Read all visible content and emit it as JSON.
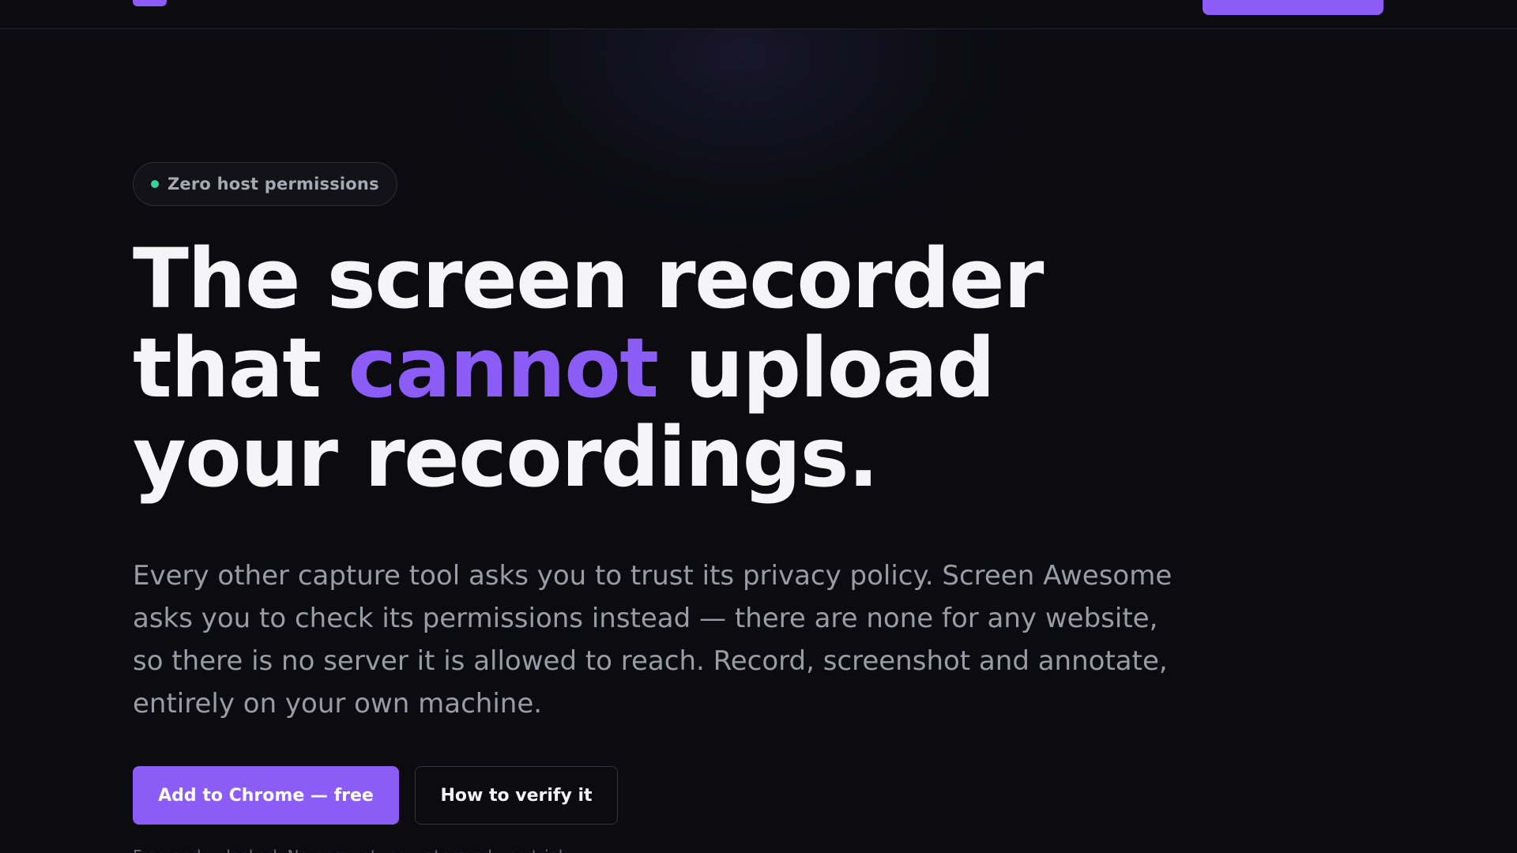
{
  "brand": {
    "accent": "#8b5cf6",
    "background": "#0b0b10",
    "status_dot": "#34d399"
  },
  "hero": {
    "badge": "Zero host permissions",
    "headline": {
      "line1": "The screen recorder",
      "line2_before": "that ",
      "line2_accent": "cannot",
      "line2_after": " upload",
      "line3": "your recordings."
    },
    "lede": "Every other capture tool asks you to trust its privacy policy. Screen Awesome asks you to check its permissions instead — there are none for any website, so there is no server it is allowed to reach. Record, screenshot and annotate, entirely on your own machine.",
    "primary_button": "Add to Chrome — free",
    "secondary_button": "How to verify it",
    "fine_print": "Free and unlocked. No account, no watermark, no trial."
  }
}
